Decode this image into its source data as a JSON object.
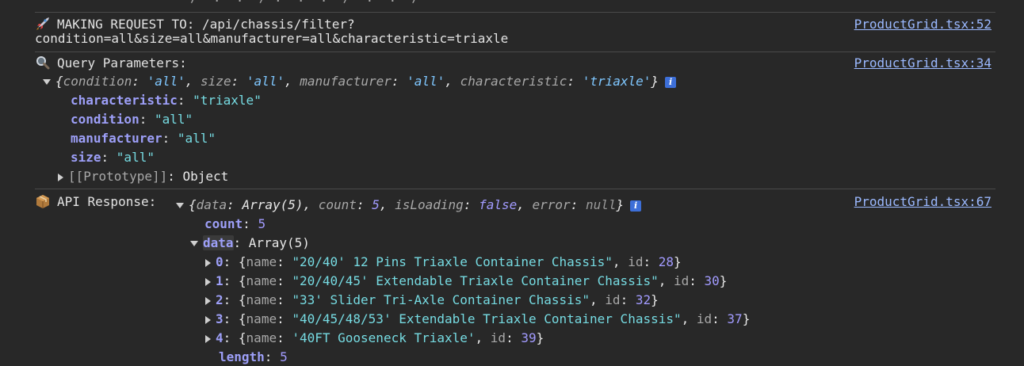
{
  "top_fragment": "/  .  .  / .  .  .  /  .  .  /",
  "entries": [
    {
      "icon": "rocket-icon",
      "label": "MAKING REQUEST TO: /api/chassis/filter?",
      "label_cont": "condition=all&size=all&manufacturer=all&characteristic=triaxle",
      "source": "ProductGrid.tsx:52"
    },
    {
      "icon": "magnifier-icon",
      "label": "Query Parameters:",
      "source": "ProductGrid.tsx:34",
      "summary": {
        "condition": "'all'",
        "size": "'all'",
        "manufacturer": "'all'",
        "characteristic": "'triaxle'"
      },
      "props": [
        {
          "key": "characteristic",
          "value": "\"triaxle\""
        },
        {
          "key": "condition",
          "value": "\"all\""
        },
        {
          "key": "manufacturer",
          "value": "\"all\""
        },
        {
          "key": "size",
          "value": "\"all\""
        }
      ],
      "prototype": "[[Prototype]]",
      "prototype_value": "Object"
    },
    {
      "icon": "package-icon",
      "label": "API Response:",
      "source": "ProductGrid.tsx:67",
      "summary": {
        "data": "Array(5)",
        "count": "5",
        "isLoading": "false",
        "error": "null"
      },
      "count_key": "count",
      "count_value": "5",
      "data_key": "data",
      "data_value": "Array(5)",
      "items": [
        {
          "index": "0",
          "name": "\"20/40' 12 Pins Triaxle Container Chassis\"",
          "id": "28"
        },
        {
          "index": "1",
          "name": "\"20/40/45' Extendable Triaxle Container Chassis\"",
          "id": "30"
        },
        {
          "index": "2",
          "name": "\"33' Slider Tri-Axle Container Chassis\"",
          "id": "32"
        },
        {
          "index": "3",
          "name": "\"40/45/48/53' Extendable Triaxle Container Chassis\"",
          "id": "37"
        },
        {
          "index": "4",
          "name": "'40FT Gooseneck Triaxle'",
          "id": "39"
        }
      ],
      "length_key": "length",
      "length_value": "5"
    }
  ]
}
